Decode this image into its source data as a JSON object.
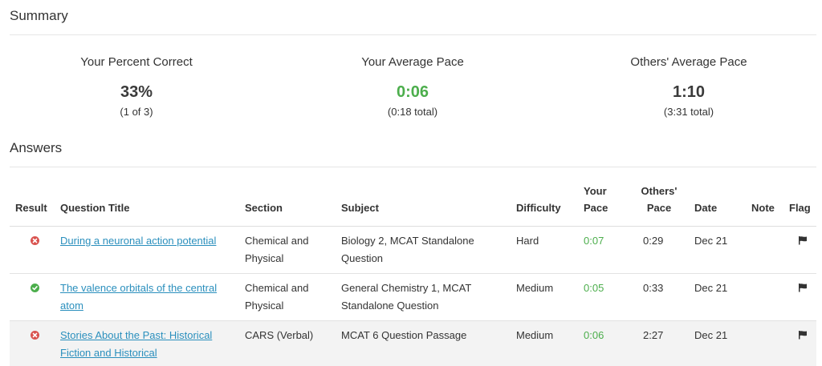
{
  "summary": {
    "title": "Summary",
    "percent_label": "Your Percent Correct",
    "percent_value": "33%",
    "percent_sub": "(1 of 3)",
    "pace_label": "Your Average Pace",
    "pace_value": "0:06",
    "pace_sub": "(0:18 total)",
    "others_label": "Others' Average Pace",
    "others_value": "1:10",
    "others_sub": "(3:31 total)"
  },
  "answers": {
    "title": "Answers",
    "headers": {
      "result": "Result",
      "title": "Question Title",
      "section": "Section",
      "subject": "Subject",
      "difficulty": "Difficulty",
      "your_pace_1": "Your",
      "your_pace_2": "Pace",
      "others_pace_1": "Others'",
      "others_pace_2": "Pace",
      "date": "Date",
      "note": "Note",
      "flag": "Flag"
    },
    "rows": [
      {
        "result": "incorrect",
        "title": "During a neuronal action potential",
        "section": "Chemical and Physical",
        "subject": "Biology 2, MCAT Standalone Question",
        "difficulty": "Hard",
        "your_pace": "0:07",
        "others_pace": "0:29",
        "date": "Dec 21",
        "note": ""
      },
      {
        "result": "correct",
        "title": "The valence orbitals of the central atom",
        "section": "Chemical and Physical",
        "subject": "General Chemistry 1, MCAT Standalone Question",
        "difficulty": "Medium",
        "your_pace": "0:05",
        "others_pace": "0:33",
        "date": "Dec 21",
        "note": ""
      },
      {
        "result": "incorrect",
        "title": "Stories About the Past: Historical Fiction and Historical",
        "section": "CARS (Verbal)",
        "subject": "MCAT 6 Question Passage",
        "difficulty": "Medium",
        "your_pace": "0:06",
        "others_pace": "2:27",
        "date": "Dec 21",
        "note": ""
      }
    ]
  },
  "colors": {
    "correct": "#4cae4c",
    "incorrect": "#d9534f",
    "link": "#2a8fbd"
  },
  "icons": {
    "incorrect": "x-circle-icon",
    "correct": "check-circle-icon",
    "flag": "flag-icon"
  }
}
